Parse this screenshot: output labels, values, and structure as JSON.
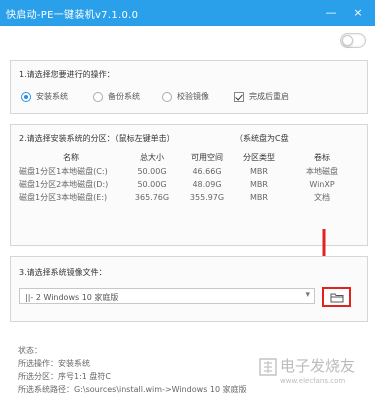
{
  "window": {
    "title": "快启动-PE一键装机v7.1.0.0",
    "minimize": "—",
    "close": "×"
  },
  "section1": {
    "title": "1.请选择您要进行的操作：",
    "options": [
      {
        "label": "安装系统",
        "selected": true
      },
      {
        "label": "备份系统",
        "selected": false
      },
      {
        "label": "校验镜像",
        "selected": false
      }
    ],
    "reboot_label": "完成后重启",
    "reboot_checked": true
  },
  "section2": {
    "title": "2.请选择安装系统的分区：（鼠标左键单击）",
    "note": "（系统盘为C盘",
    "headers": [
      "名称",
      "总大小",
      "可用空间",
      "分区类型",
      "卷标"
    ],
    "rows": [
      [
        "磁盘1分区1本地磁盘(C:)",
        "50.00G",
        "46.66G",
        "MBR",
        "本地磁盘"
      ],
      [
        "磁盘1分区2本地磁盘(D:)",
        "50.00G",
        "48.09G",
        "MBR",
        "WinXP"
      ],
      [
        "磁盘1分区3本地磁盘(E:)",
        "365.76G",
        "355.97G",
        "MBR",
        "文档"
      ]
    ]
  },
  "section3": {
    "title": "3.请选择系统镜像文件：",
    "selected_image": "||- 2 Windows  10 家庭版",
    "combo_arrow": "▾"
  },
  "status": {
    "heading": "状态：",
    "lines": [
      "所选操作：安装系统",
      "所选分区：序号1:1    盘符C",
      "所选系统路径：G:\\sources\\install.wim->Windows  10 家庭版"
    ]
  },
  "watermark": {
    "name": "电子发烧友",
    "url": "www.elecfans.com"
  },
  "colors": {
    "titlebar": "#2ba0ea",
    "accent": "#2b8fe0",
    "annotation": "#e0231f"
  }
}
